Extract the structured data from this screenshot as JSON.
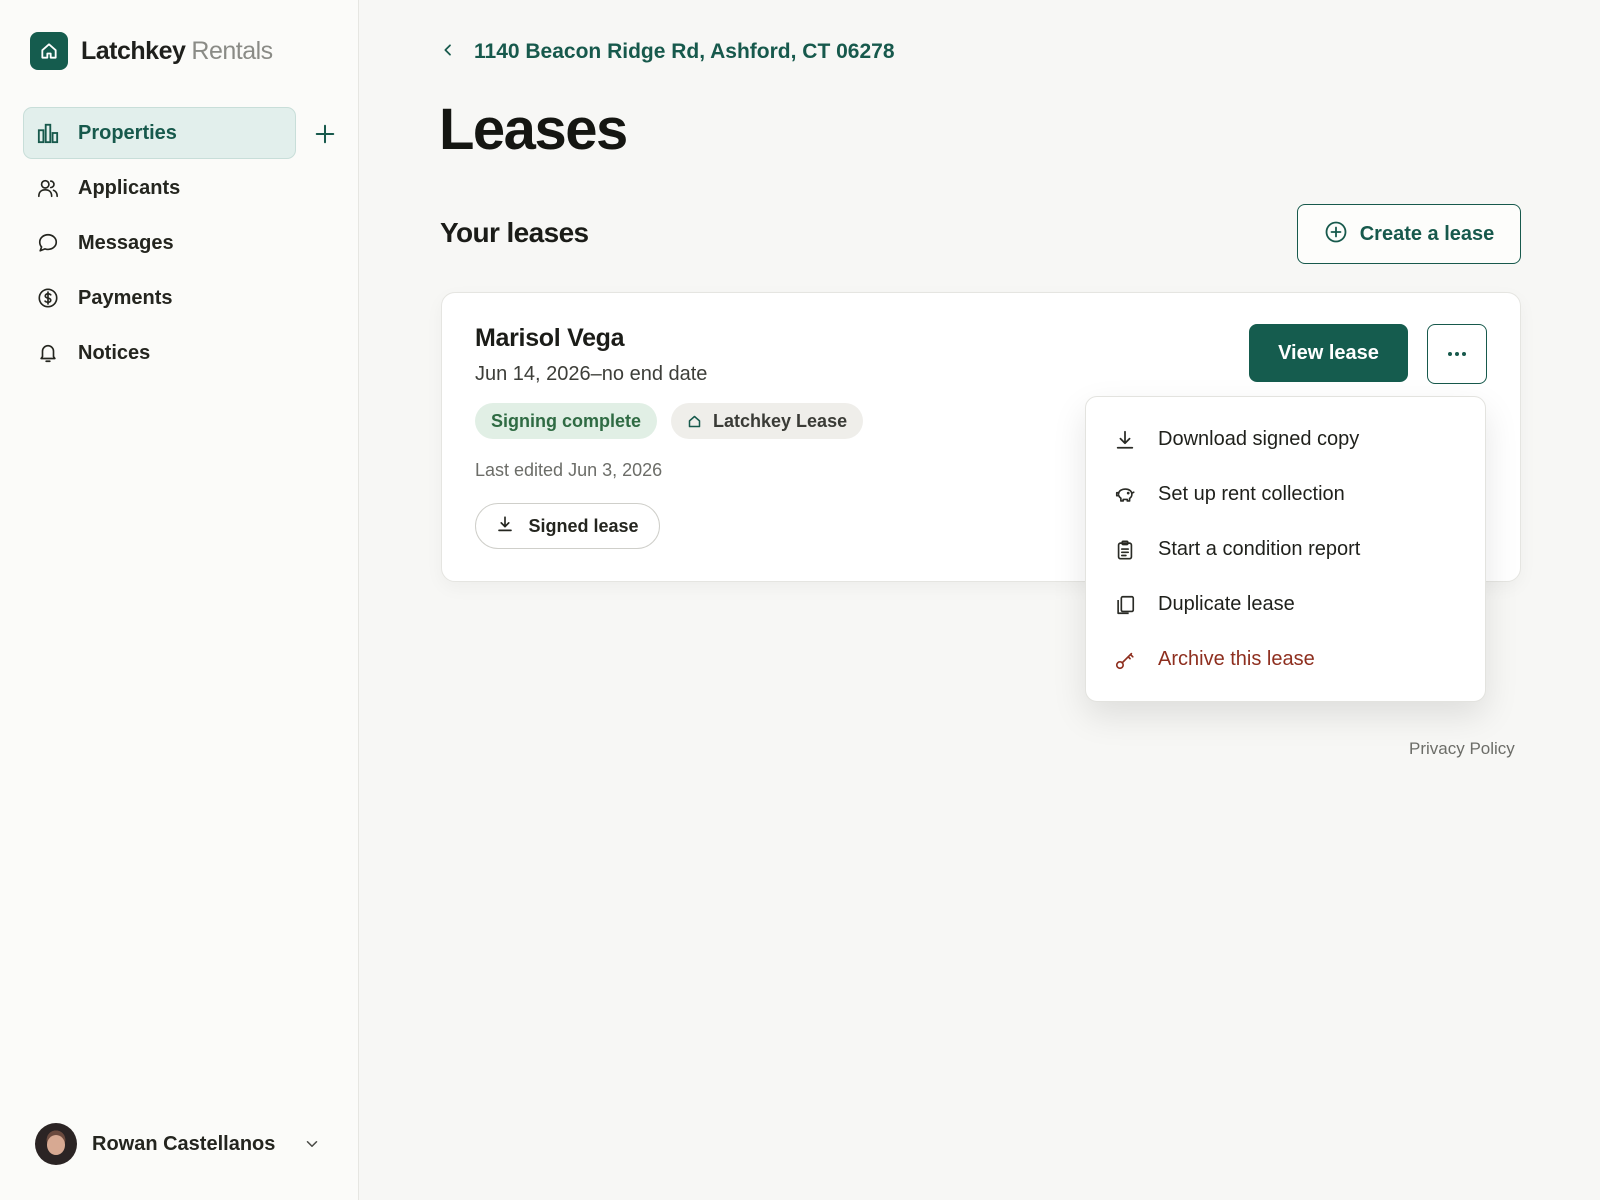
{
  "brand": {
    "name": "Latchkey",
    "sub": "Rentals",
    "logo_icon": "home-icon"
  },
  "nav": {
    "items": [
      {
        "label": "Properties",
        "icon": "bar-chart-icon",
        "active": true
      },
      {
        "label": "Applicants",
        "icon": "users-icon"
      },
      {
        "label": "Messages",
        "icon": "chat-bubble-icon"
      },
      {
        "label": "Payments",
        "icon": "dollar-circle-icon"
      },
      {
        "label": "Notices",
        "icon": "bell-icon"
      }
    ],
    "add_icon": "plus-icon"
  },
  "user": {
    "name": "Rowan Castellanos"
  },
  "breadcrumb": {
    "label": "1140 Beacon Ridge Rd, Ashford, CT 06278"
  },
  "page": {
    "title": "Leases",
    "section_title": "Your leases",
    "create_label": "Create a lease"
  },
  "lease": {
    "tenant": "Marisol Vega",
    "dates": "Jun 14, 2026–no end date",
    "status_badge": "Signing complete",
    "type_badge": "Latchkey Lease",
    "edited": "Last edited Jun 3, 2026",
    "signed_label": "Signed lease",
    "view_label": "View lease",
    "more_icon": "ellipsis-icon"
  },
  "menu": {
    "items": [
      {
        "label": "Download signed copy",
        "icon": "download-icon"
      },
      {
        "label": "Set up rent collection",
        "icon": "piggy-bank-icon"
      },
      {
        "label": "Start a condition report",
        "icon": "clipboard-icon"
      },
      {
        "label": "Duplicate lease",
        "icon": "copy-icon"
      },
      {
        "label": "Archive this lease",
        "icon": "key-icon",
        "danger": true
      }
    ]
  },
  "footer": {
    "privacy": "Privacy Policy"
  },
  "colors": {
    "accent": "#155c4e",
    "active_bg": "#e2efec",
    "danger": "#8e2f1f",
    "badge_green_bg": "#e1efe5",
    "page_bg": "#f7f7f5"
  }
}
